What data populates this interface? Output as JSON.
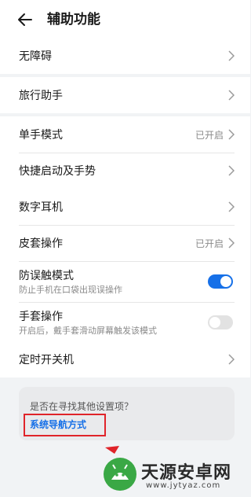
{
  "header": {
    "title": "辅助功能"
  },
  "groups": [
    {
      "rows": [
        {
          "label": "无障碍",
          "status": ""
        }
      ]
    },
    {
      "rows": [
        {
          "label": "旅行助手",
          "status": ""
        }
      ]
    },
    {
      "rows": [
        {
          "label": "单手模式",
          "status": "已开启"
        },
        {
          "label": "快捷启动及手势",
          "status": ""
        }
      ]
    },
    {
      "rows": [
        {
          "label": "数字耳机",
          "status": ""
        },
        {
          "label": "皮套操作",
          "status": "已开启"
        }
      ],
      "toggles": [
        {
          "label": "防误触模式",
          "sub": "防止手机在口袋出现误操作",
          "on": true
        },
        {
          "label": "手套操作",
          "sub": "开启后，戴手套滑动屏幕触发该模式",
          "on": false
        }
      ]
    },
    {
      "rows": [
        {
          "label": "定时开关机",
          "status": ""
        }
      ]
    }
  ],
  "card": {
    "question": "是否在寻找其他设置项？",
    "link": "系统导航方式"
  },
  "colors": {
    "accent": "#1670e8",
    "highlight": "#e0242a",
    "background": "#f1f3f5"
  },
  "watermark": {
    "name": "天源安卓网",
    "url": "www.jytyaz.com"
  }
}
